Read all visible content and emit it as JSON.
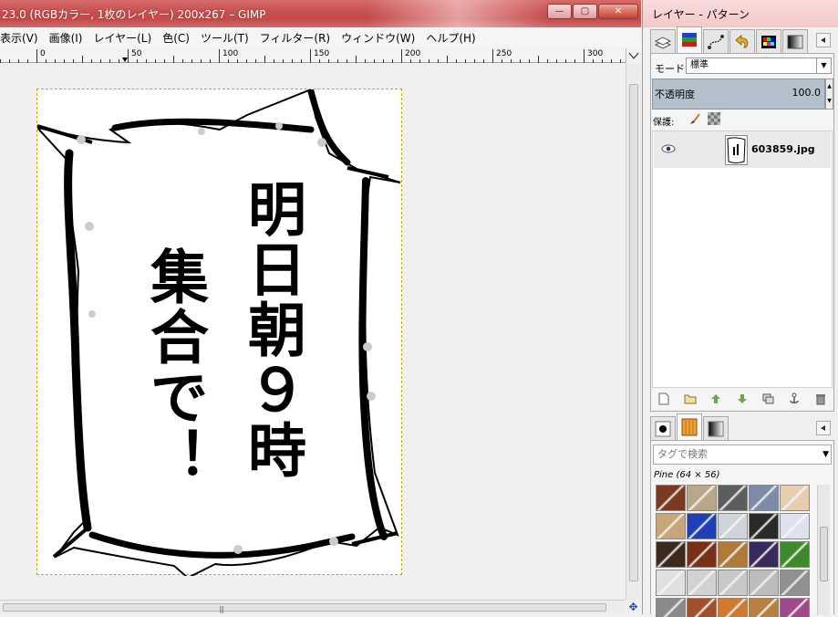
{
  "main_window": {
    "title": "23.0 (RGBカラー, 1枚のレイヤー) 200x267 – GIMP",
    "caption_buttons": {
      "minimize": "—",
      "maximize": "▢",
      "close": "✕"
    },
    "menu": [
      "表示(V)",
      "画像(I)",
      "レイヤー(L)",
      "色(C)",
      "ツール(T)",
      "フィルター(R)",
      "ウィンドウ(W)",
      "ヘルプ(H)"
    ],
    "ruler_labels": [
      "0",
      "50",
      "100",
      "150",
      "200",
      "250",
      "300"
    ],
    "canvas_text": {
      "right_column": "明日朝９時",
      "left_column": "集合で！"
    },
    "scroll_grip": "|||",
    "nav_icon": "✥"
  },
  "dock_window": {
    "title": "レイヤー - パターン",
    "top_tabs": [
      "layers-icon",
      "channels-icon",
      "paths-icon",
      "undo-history-icon",
      "colormap-icon",
      "gradient-icon"
    ],
    "layers": {
      "mode_label": "モード:",
      "mode_value": "標準",
      "opacity_label": "不透明度",
      "opacity_value": "100.0",
      "lock_label": "保護:",
      "items": [
        {
          "name": "603859.jpg",
          "visible": true
        }
      ]
    },
    "pattern_tabs": [
      "brushes-icon",
      "patterns-icon",
      "gradients-icon"
    ],
    "patterns": {
      "search_placeholder": "タグで検索",
      "selected_name": "Pine (64 × 56)",
      "swatches": [
        "#7a3a20",
        "#b8a78a",
        "#5d5d5d",
        "#7d8aa8",
        "#e6cdb0",
        "#c8a67a",
        "#1f3fb8",
        "#cfd4da",
        "#2a2a2a",
        "#dde2ee",
        "#3d2a1e",
        "#7a2f18",
        "#b07a3a",
        "#3a2a5a",
        "#3d8a2a",
        "#e0e0e0",
        "#d2d2d2",
        "#c8c8c8",
        "#bcbcbc",
        "#909090",
        "#8a8a8a",
        "#a0502a",
        "#d07a30",
        "#b88040",
        "#a04a8a"
      ]
    }
  }
}
